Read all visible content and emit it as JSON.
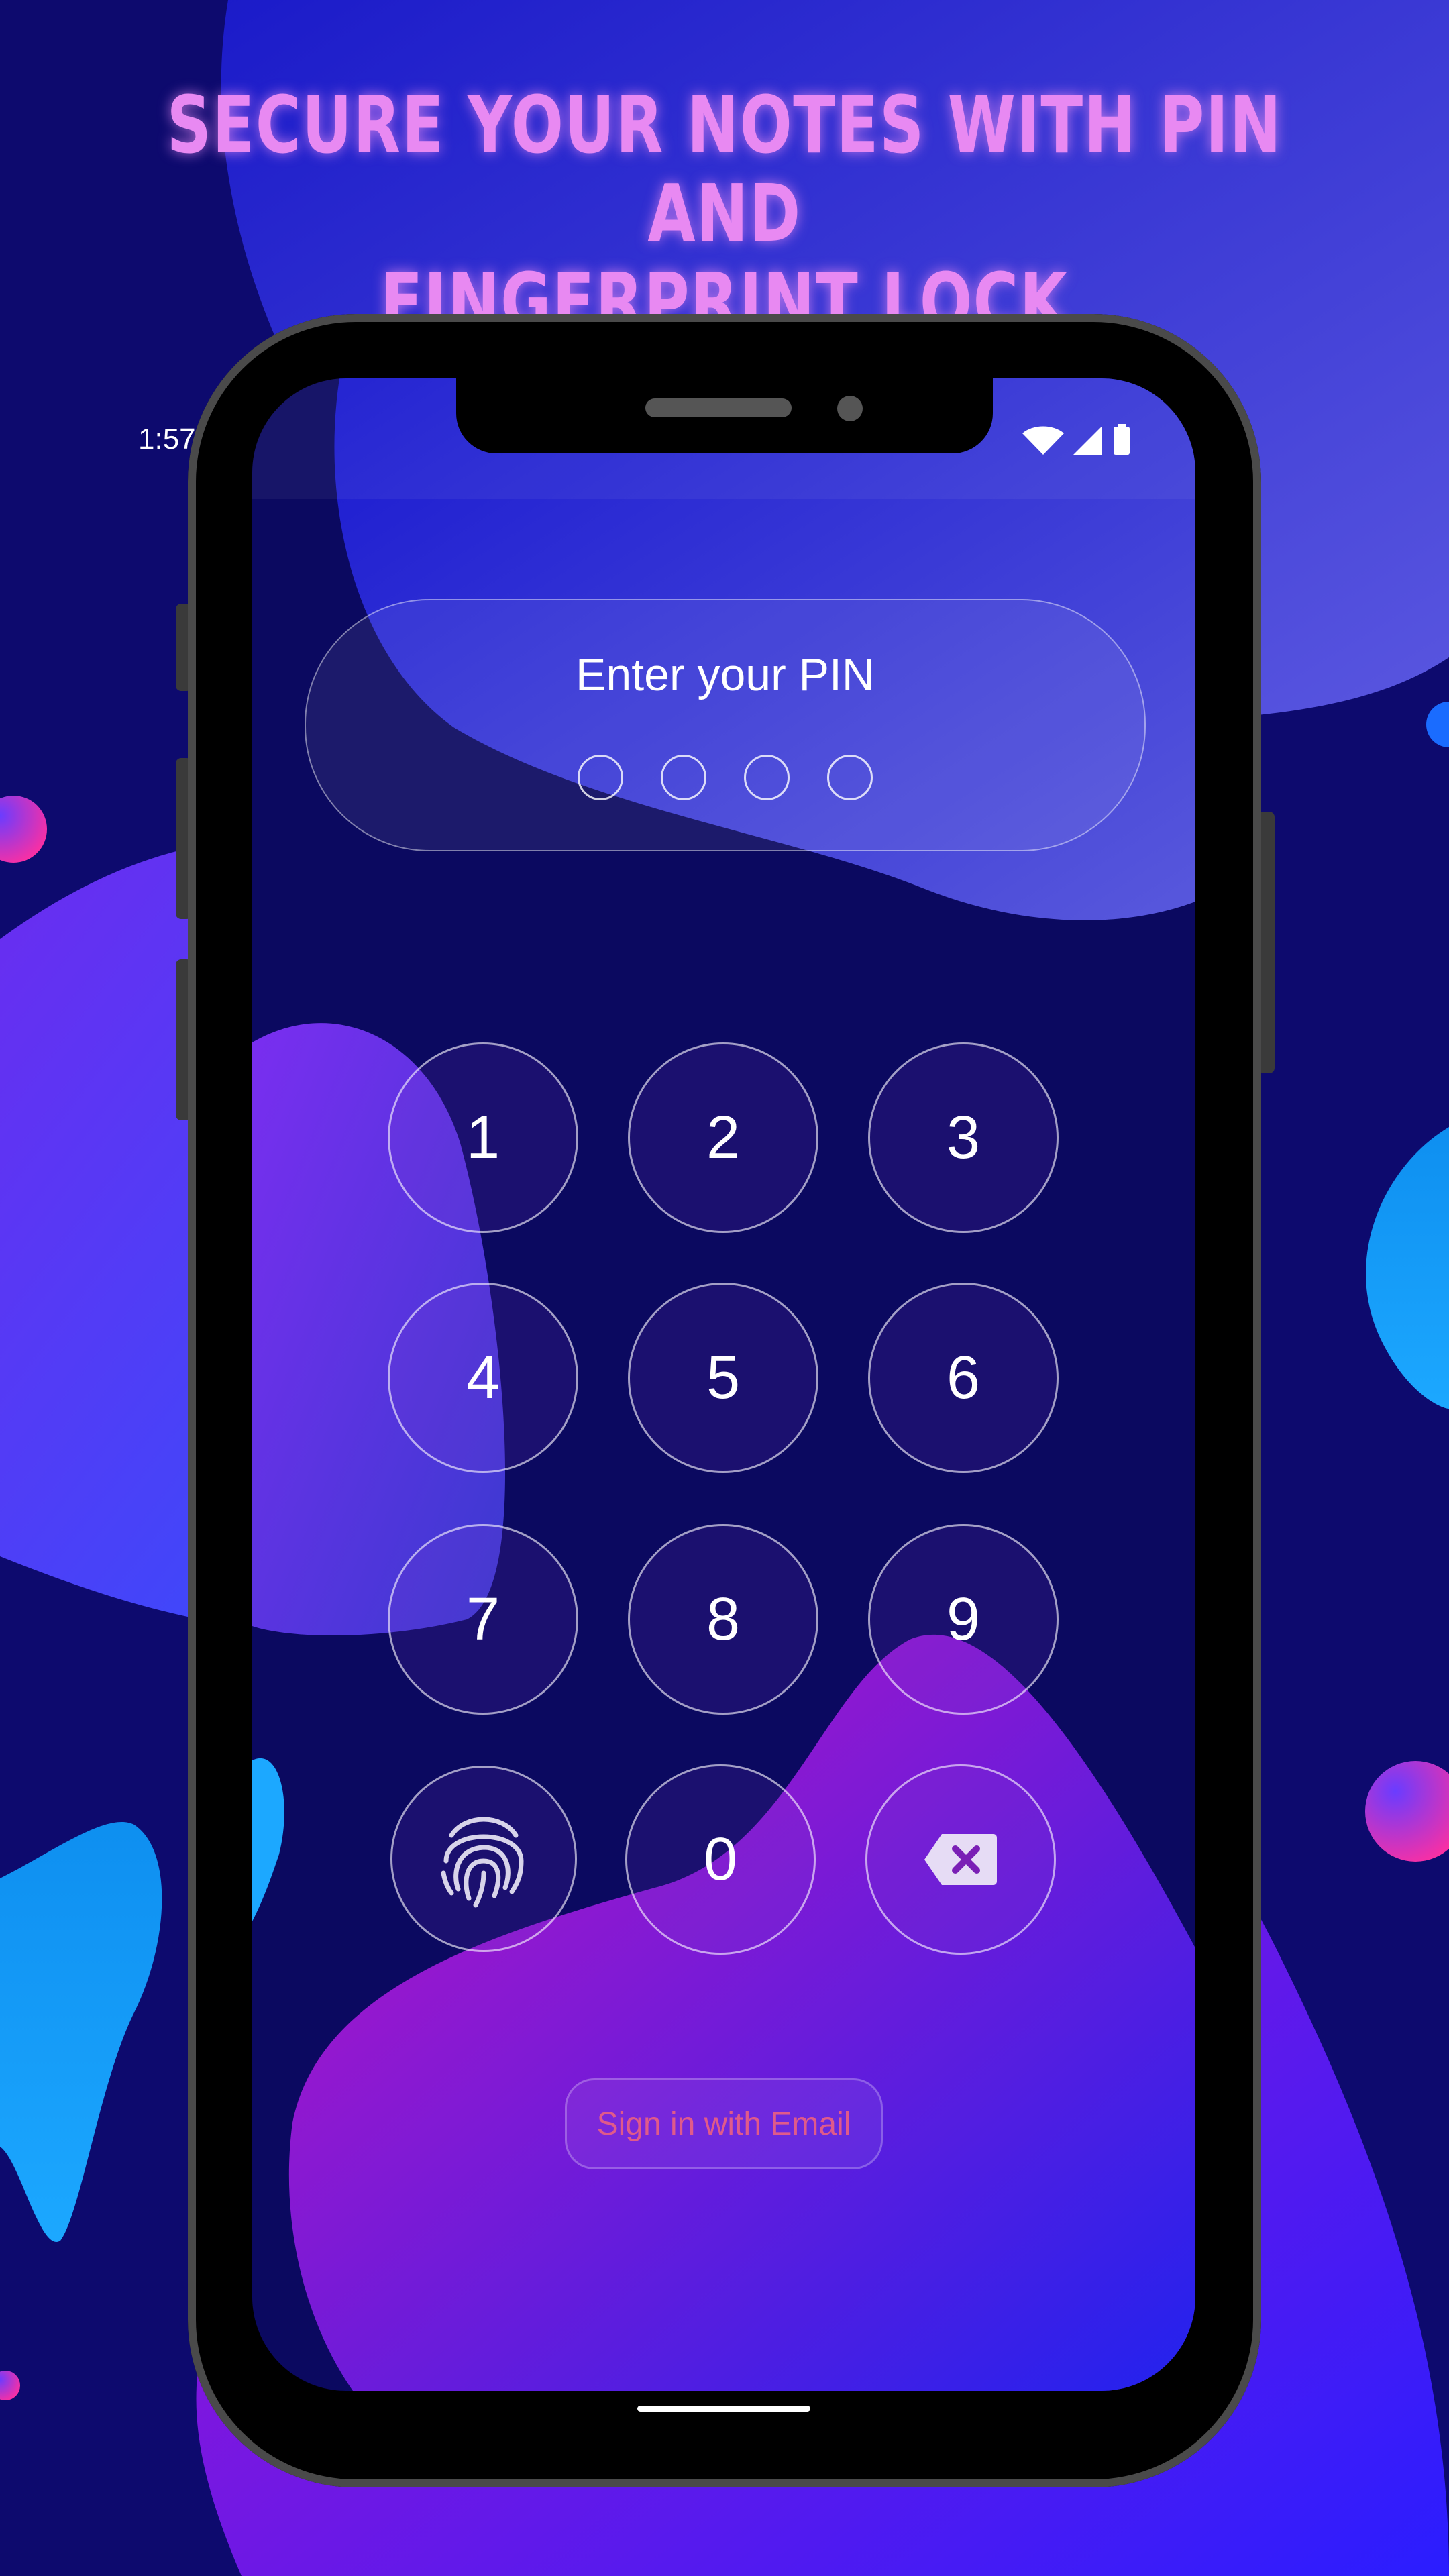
{
  "headline": {
    "line1": "SECURE YOUR NOTES WITH PIN AND",
    "line2": "FINGERPRINT LOCK"
  },
  "status_bar": {
    "time": "1:57",
    "icons": [
      "wifi-icon",
      "signal-icon",
      "battery-icon"
    ]
  },
  "pin_entry": {
    "title": "Enter your PIN",
    "digits_entered": 0,
    "pin_length": 4
  },
  "keypad": {
    "keys": [
      "1",
      "2",
      "3",
      "4",
      "5",
      "6",
      "7",
      "8",
      "9",
      "fingerprint-icon",
      "0",
      "backspace-icon"
    ]
  },
  "email_signin": {
    "label": "Sign in with Email"
  },
  "colors": {
    "headline": "#e889f2",
    "background": "#0d0a6e",
    "email_text": "#e05a8a"
  }
}
